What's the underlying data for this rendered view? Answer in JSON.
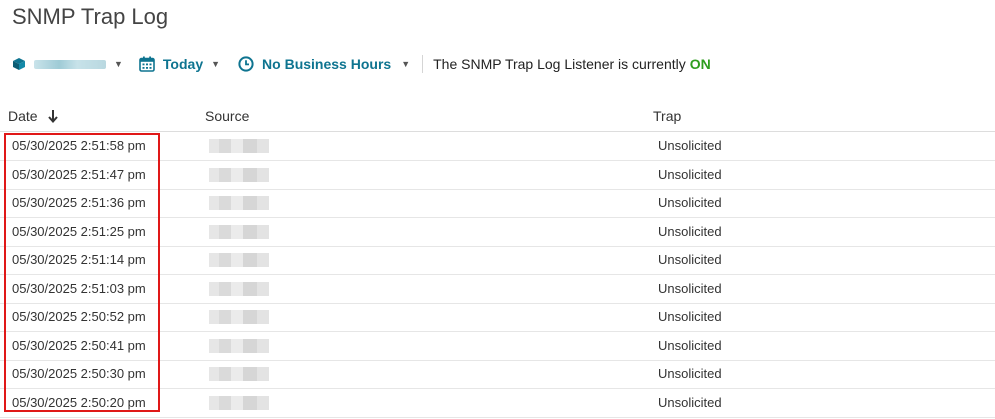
{
  "page_title": "SNMP Trap Log",
  "toolbar": {
    "device_filter": {
      "icon": "cube-icon",
      "value": ""
    },
    "date_filter": {
      "icon": "calendar-icon",
      "label": "Today"
    },
    "hours_filter": {
      "icon": "clock-icon",
      "label": "No Business Hours"
    },
    "listener_status": {
      "text": "The SNMP Trap Log Listener is currently",
      "state": "ON",
      "state_color": "#2e9d1e"
    }
  },
  "colors": {
    "accent": "#0e7490",
    "highlight": "#e01818"
  },
  "table": {
    "columns": {
      "date": "Date",
      "source": "Source",
      "trap": "Trap"
    },
    "sort_icon": "arrow-down-icon",
    "rows": [
      {
        "date": "05/30/2025 2:51:58 pm",
        "source": "",
        "trap": "Unsolicited"
      },
      {
        "date": "05/30/2025 2:51:47 pm",
        "source": "",
        "trap": "Unsolicited"
      },
      {
        "date": "05/30/2025 2:51:36 pm",
        "source": "",
        "trap": "Unsolicited"
      },
      {
        "date": "05/30/2025 2:51:25 pm",
        "source": "",
        "trap": "Unsolicited"
      },
      {
        "date": "05/30/2025 2:51:14 pm",
        "source": "",
        "trap": "Unsolicited"
      },
      {
        "date": "05/30/2025 2:51:03 pm",
        "source": "",
        "trap": "Unsolicited"
      },
      {
        "date": "05/30/2025 2:50:52 pm",
        "source": "",
        "trap": "Unsolicited"
      },
      {
        "date": "05/30/2025 2:50:41 pm",
        "source": "",
        "trap": "Unsolicited"
      },
      {
        "date": "05/30/2025 2:50:30 pm",
        "source": "",
        "trap": "Unsolicited"
      },
      {
        "date": "05/30/2025 2:50:20 pm",
        "source": "",
        "trap": "Unsolicited"
      }
    ]
  }
}
